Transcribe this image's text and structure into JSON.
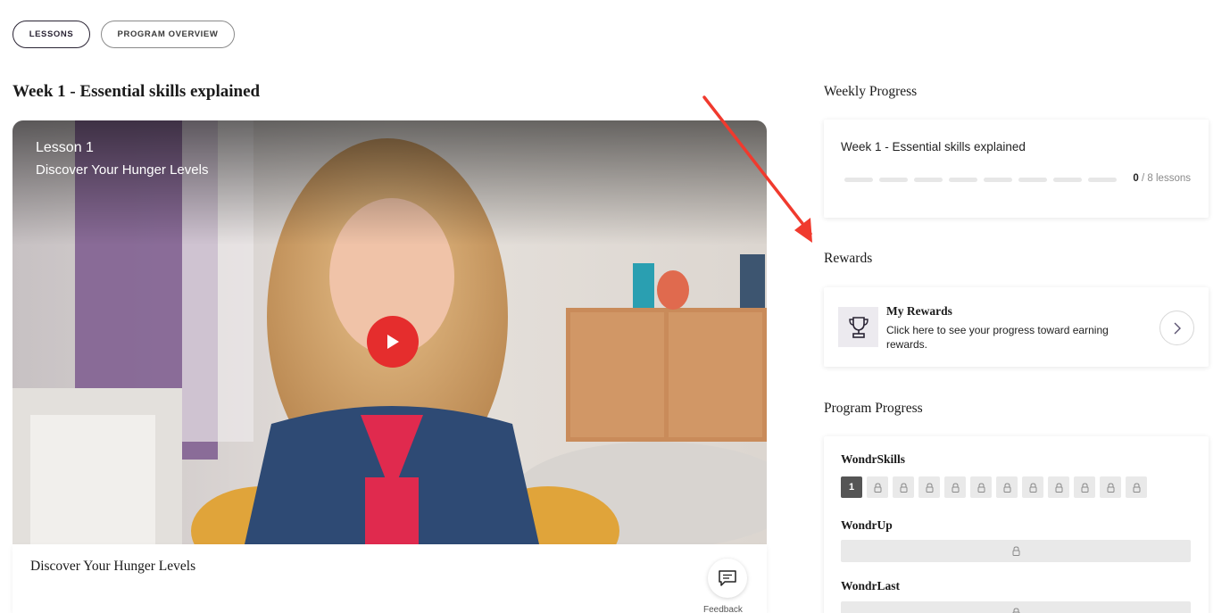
{
  "tabs": [
    {
      "label": "LESSONS",
      "active": true
    },
    {
      "label": "PROGRAM OVERVIEW",
      "active": false
    }
  ],
  "week_title": "Week 1 - Essential skills explained",
  "video": {
    "lesson_label": "Lesson 1",
    "lesson_subtitle": "Discover Your Hunger Levels",
    "play_color": "#e52d2d"
  },
  "caption": {
    "title": "Discover Your Hunger Levels",
    "feedback_label": "Feedback"
  },
  "weekly_progress": {
    "section_title": "Weekly Progress",
    "card_title": "Week 1 - Essential skills explained",
    "completed": "0",
    "total_text": "/ 8 lessons",
    "segments": 8
  },
  "rewards": {
    "section_title": "Rewards",
    "title": "My Rewards",
    "description": "Click here to see your progress toward earning rewards.",
    "icon": "trophy-icon"
  },
  "program_progress": {
    "section_title": "Program Progress",
    "wondr_skills": {
      "label": "WondrSkills",
      "first": "1",
      "locked_count": 11
    },
    "wondr_up": {
      "label": "WondrUp"
    },
    "wondr_last": {
      "label": "WondrLast"
    }
  }
}
